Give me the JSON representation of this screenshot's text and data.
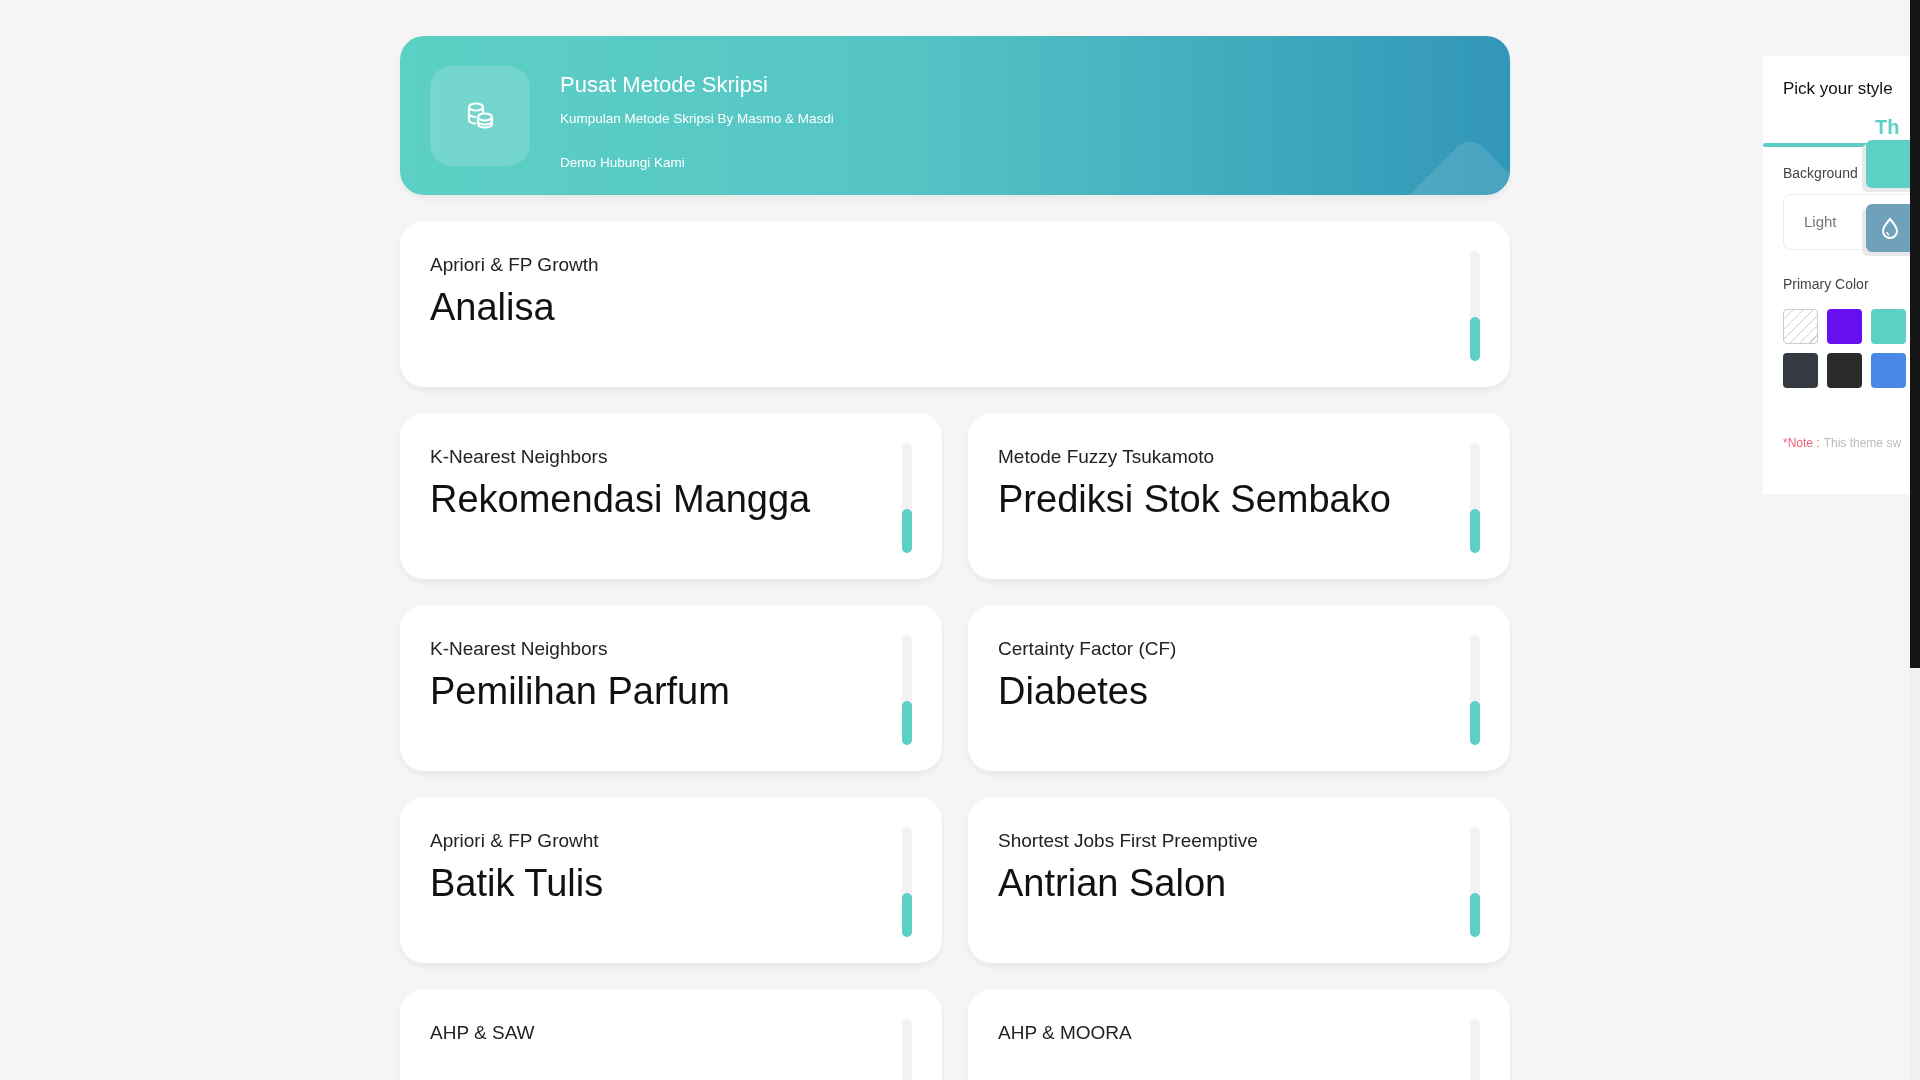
{
  "header": {
    "title": "Pusat Metode Skripsi",
    "subtitle": "Kumpulan Metode Skripsi By Masmo & Masdi",
    "links": [
      "Demo",
      "Hubungi Kami"
    ]
  },
  "cards": [
    {
      "subtitle": "Apriori & FP Growth",
      "title": "Analisa",
      "full_width": true,
      "level": 0.4
    },
    {
      "subtitle": "K-Nearest Neighbors",
      "title": "Rekomendasi Mangga",
      "full_width": false,
      "level": 0.4
    },
    {
      "subtitle": "Metode Fuzzy Tsukamoto",
      "title": "Prediksi Stok Sembako",
      "full_width": false,
      "level": 0.4
    },
    {
      "subtitle": "K-Nearest Neighbors",
      "title": "Pemilihan Parfum",
      "full_width": false,
      "level": 0.4
    },
    {
      "subtitle": "Certainty Factor (CF)",
      "title": "Diabetes",
      "full_width": false,
      "level": 0.4
    },
    {
      "subtitle": "Apriori & FP Growht",
      "title": "Batik Tulis",
      "full_width": false,
      "level": 0.4
    },
    {
      "subtitle": "Shortest Jobs First Preemptive",
      "title": "Antrian Salon",
      "full_width": false,
      "level": 0.4
    },
    {
      "subtitle": "AHP & SAW",
      "full_width": false
    },
    {
      "subtitle": "AHP & MOORA",
      "full_width": false
    }
  ],
  "style_panel": {
    "title": "Pick your style",
    "tab": "Th",
    "background_label": "Background",
    "background_value": "Light",
    "primary_color_label": "Primary Color",
    "swatches": [
      {
        "kind": "none"
      },
      {
        "kind": "solid",
        "color": "#6610f2"
      },
      {
        "kind": "solid",
        "color": "#5dd0c5"
      },
      {
        "kind": "solid",
        "color": "#343a40"
      },
      {
        "kind": "solid",
        "color": "#2a2a2a"
      },
      {
        "kind": "solid",
        "color": "#4a88e8"
      }
    ],
    "note_label": "*Note :",
    "note_text": "This theme sw"
  }
}
